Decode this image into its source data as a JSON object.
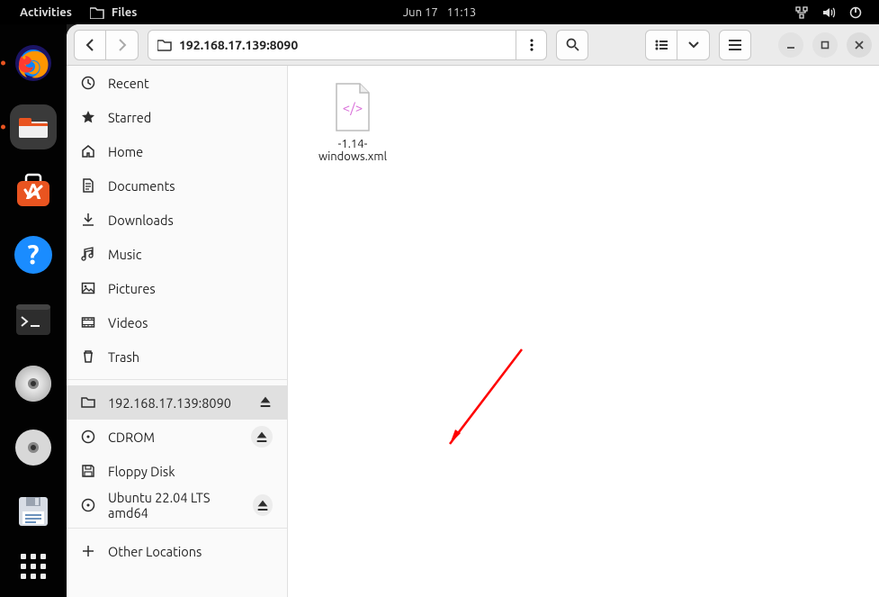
{
  "topbar": {
    "activities": "Activities",
    "app_name": "Files",
    "date": "Jun 17",
    "time": "11:13"
  },
  "window": {
    "path": "192.168.17.139:8090"
  },
  "sidebar": {
    "recent": "Recent",
    "starred": "Starred",
    "home": "Home",
    "documents": "Documents",
    "downloads": "Downloads",
    "music": "Music",
    "pictures": "Pictures",
    "videos": "Videos",
    "trash": "Trash",
    "mount_network": "192.168.17.139:8090",
    "cdrom": "CDROM",
    "floppy": "Floppy Disk",
    "ubuntu_iso": "Ubuntu 22.04 LTS amd64",
    "other_locations": "Other Locations"
  },
  "files": [
    {
      "name": "-1.14-windows.xml"
    }
  ]
}
